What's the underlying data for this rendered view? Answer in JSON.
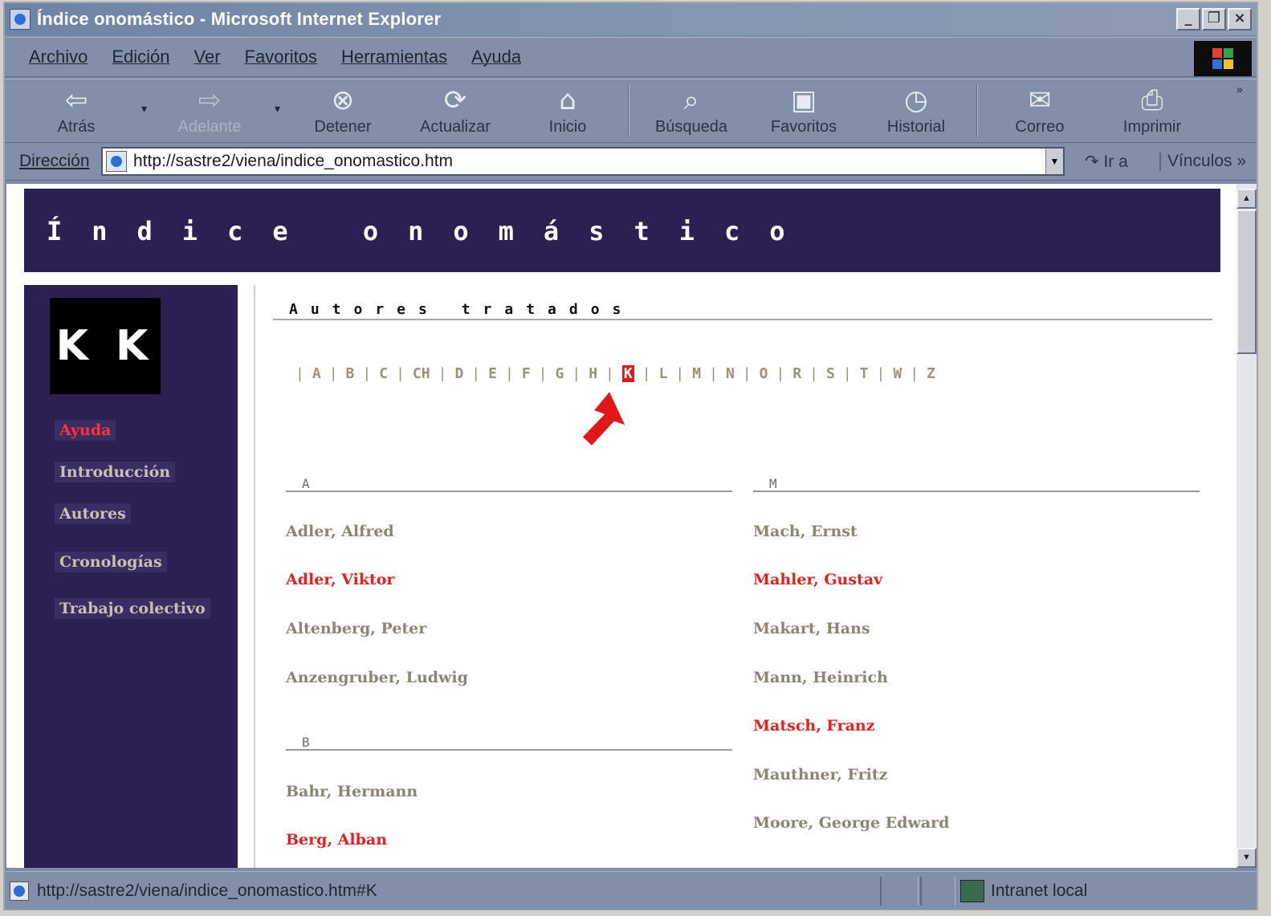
{
  "window": {
    "title": "Índice onomástico - Microsoft Internet Explorer",
    "buttons": {
      "minimize": "_",
      "restore": "❐",
      "close": "×"
    }
  },
  "menu": [
    "Archivo",
    "Edición",
    "Ver",
    "Favoritos",
    "Herramientas",
    "Ayuda"
  ],
  "toolbar": [
    {
      "label": "Atrás",
      "icon": "back-arrow-icon",
      "glyph": "⇦",
      "disabled": false
    },
    {
      "label": "Adelante",
      "icon": "forward-arrow-icon",
      "glyph": "⇨",
      "disabled": true
    },
    {
      "label": "Detener",
      "icon": "stop-icon",
      "glyph": "⊗",
      "disabled": false
    },
    {
      "label": "Actualizar",
      "icon": "refresh-icon",
      "glyph": "⟳",
      "disabled": false
    },
    {
      "label": "Inicio",
      "icon": "home-icon",
      "glyph": "⌂",
      "disabled": false
    },
    {
      "label": "Búsqueda",
      "icon": "search-icon",
      "glyph": "⌕",
      "disabled": false
    },
    {
      "label": "Favoritos",
      "icon": "favorites-icon",
      "glyph": "▣",
      "disabled": false
    },
    {
      "label": "Historial",
      "icon": "history-icon",
      "glyph": "◷",
      "disabled": false
    },
    {
      "label": "Correo",
      "icon": "mail-icon",
      "glyph": "✉",
      "disabled": false
    },
    {
      "label": "Imprimir",
      "icon": "print-icon",
      "glyph": "⎙",
      "disabled": false
    }
  ],
  "address": {
    "label": "Dirección",
    "url": "http://sastre2/viena/indice_onomastico.htm",
    "go_label": "Ir a",
    "links_label": "Vínculos"
  },
  "page": {
    "banner_title": "Índice onomástico",
    "logo_text": "K K",
    "sidebar": [
      {
        "label": "Ayuda",
        "active": true
      },
      {
        "label": "Introducción",
        "active": false
      },
      {
        "label": "Autores",
        "active": false
      },
      {
        "label": "Cronologías",
        "active": false
      },
      {
        "label": "Trabajo colectivo",
        "active": false
      }
    ],
    "section_title": "Autores tratados",
    "letters": [
      "A",
      "B",
      "C",
      "CH",
      "D",
      "E",
      "F",
      "G",
      "H",
      "K",
      "L",
      "M",
      "N",
      "O",
      "R",
      "S",
      "T",
      "W",
      "Z"
    ],
    "active_letter": "K",
    "left_column": {
      "groups": [
        {
          "letter": "A",
          "names": [
            {
              "name": "Adler, Alfred",
              "highlight": false
            },
            {
              "name": "Adler, Viktor",
              "highlight": true
            },
            {
              "name": "Altenberg, Peter",
              "highlight": false
            },
            {
              "name": "Anzengruber, Ludwig",
              "highlight": false
            }
          ]
        },
        {
          "letter": "B",
          "names": [
            {
              "name": "Bahr, Hermann",
              "highlight": false
            },
            {
              "name": "Berg, Alban",
              "highlight": true
            }
          ]
        }
      ]
    },
    "right_column": {
      "groups": [
        {
          "letter": "M",
          "names": [
            {
              "name": "Mach, Ernst",
              "highlight": false
            },
            {
              "name": "Mahler, Gustav",
              "highlight": true
            },
            {
              "name": "Makart, Hans",
              "highlight": false
            },
            {
              "name": "Mann, Heinrich",
              "highlight": false
            },
            {
              "name": "Matsch, Franz",
              "highlight": true
            },
            {
              "name": "Mauthner, Fritz",
              "highlight": false
            },
            {
              "name": "Moore, George Edward",
              "highlight": false
            }
          ]
        }
      ]
    }
  },
  "status": {
    "text": "http://sastre2/viena/indice_onomastico.htm#K",
    "zone": "Intranet local"
  },
  "colors": {
    "banner_bg": "#2c1f52",
    "highlight_red": "#e62020",
    "name_gray": "#8c8572"
  }
}
